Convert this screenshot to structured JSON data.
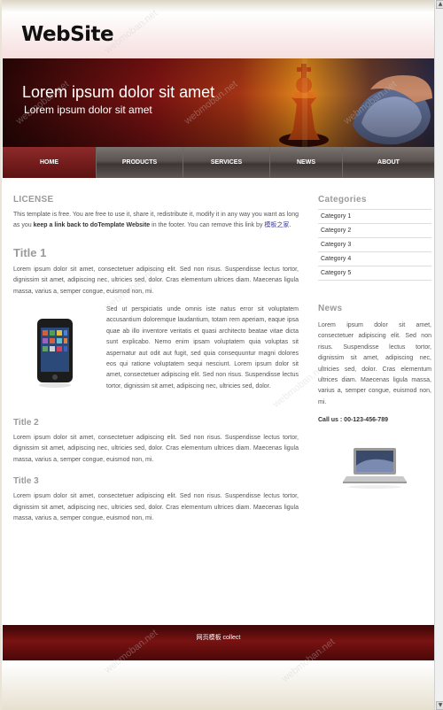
{
  "site": {
    "logo": "WebSite"
  },
  "banner": {
    "headline": "Lorem ipsum dolor sit amet",
    "subline": "Lorem ipsum dolor sit amet"
  },
  "nav": {
    "items": [
      "HOME",
      "PRODUCTS",
      "SERVICES",
      "NEWS",
      "ABOUT"
    ],
    "active": "HOME"
  },
  "license": {
    "heading": "LICENSE",
    "text_before": "This template is free. You are free to use it, share it, redistribute it, modify it in any way you want as long as you ",
    "text_bold": "keep a link back to doTemplate Website",
    "text_after": " in the footer. You can remove this link by ",
    "link_text": "模板之家",
    "text_end": "."
  },
  "title1": {
    "heading": "Title 1",
    "para1": "Lorem ipsum dolor sit amet, consectetuer adipiscing elit. Sed non risus. Suspendisse lectus tortor, dignissim sit amet, adipiscing nec, ultricies sed, dolor. Cras elementum ultrices diam. Maecenas ligula massa, varius a, semper congue, euismod non, mi.",
    "para2": "Sed ut perspiciatis unde omnis iste natus error sit voluptatem accusantium doloremque laudantium, totam rem aperiam, eaque ipsa quae ab illo inventore veritatis et quasi architecto beatae vitae dicta sunt explicabo. Nemo enim ipsam voluptatem quia voluptas sit aspernatur aut odit aut fugit, sed quia consequuntur magni dolores eos qui ratione voluptatem sequi nesciunt. Lorem ipsum dolor sit amet, consectetuer adipiscing elit. Sed non risus. Suspendisse lectus tortor, dignissim sit amet, adipiscing nec, ultricies sed, dolor."
  },
  "title2": {
    "heading": "Title 2",
    "para": "Lorem ipsum dolor sit amet, consectetuer adipiscing elit. Sed non risus. Suspendisse lectus tortor, dignissim sit amet, adipiscing nec, ultricies sed, dolor. Cras elementum ultrices diam. Maecenas ligula massa, varius a, semper congue, euismod non, mi."
  },
  "title3": {
    "heading": "Title 3",
    "para": "Lorem ipsum dolor sit amet, consectetuer adipiscing elit. Sed non risus. Suspendisse lectus tortor, dignissim sit amet, adipiscing nec, ultricies sed, dolor. Cras elementum ultrices diam. Maecenas ligula massa, varius a, semper congue, euismod non, mi."
  },
  "sidebar": {
    "categories_heading": "Categories",
    "categories": [
      "Category 1",
      "Category 2",
      "Category 3",
      "Category 4",
      "Category 5"
    ],
    "news_heading": "News",
    "news_text": "Lorem ipsum dolor sit amet, consectetuer adipiscing elit. Sed non risus. Suspendisse lectus tortor, dignissim sit amet, adipiscing nec, ultricies sed, dolor. Cras elementum ultrices diam. Maecenas ligula massa, varius a, semper congue, euismod non, mi.",
    "call_label": "Call us : 00-123-456-789"
  },
  "footer": {
    "text": "网页模板 collect"
  },
  "watermark": "webmoban.net",
  "colors": {
    "accent": "#7a1212",
    "nav": "#59524f",
    "heading_grey": "#9a9a9a"
  }
}
